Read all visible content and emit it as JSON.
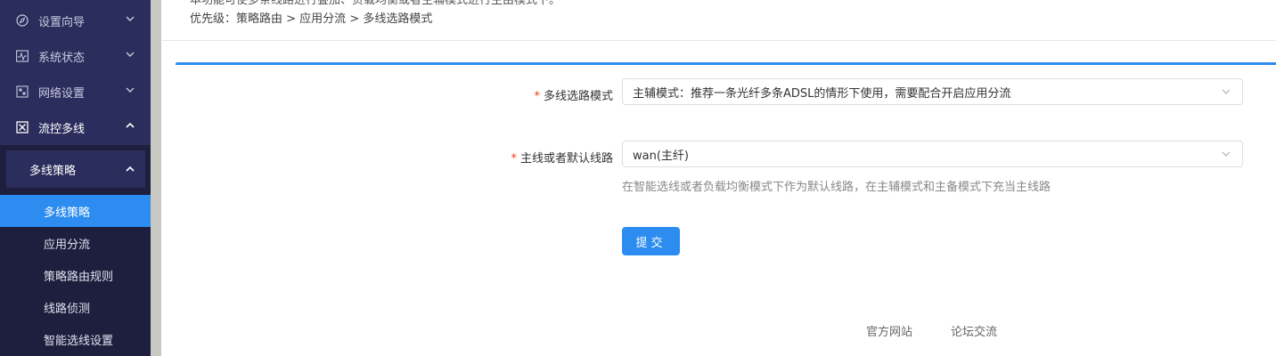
{
  "sidebar": {
    "items": [
      {
        "label": "设置向导",
        "icon": "compass-icon"
      },
      {
        "label": "系统状态",
        "icon": "activity-icon"
      },
      {
        "label": "网络设置",
        "icon": "network-icon"
      },
      {
        "label": "流控多线",
        "icon": "multiline-icon"
      }
    ],
    "submenu": {
      "group_label": "多线策略",
      "leaves": [
        "多线策略",
        "应用分流",
        "策略路由规则",
        "线路侦测",
        "智能选线设置"
      ],
      "selected_index": 0
    }
  },
  "header": {
    "partial_text": "本功能可使多条线路进行叠加、负载均衡或者主辅模式进行主由模式下。",
    "priority_text": "优先级：策略路由 > 应用分流 > 多线选路模式"
  },
  "form": {
    "mode_label": "多线选路模式",
    "mode_value": "主辅模式：推荐一条光纤多条ADSL的情形下使用，需要配合开启应用分流",
    "line_label": "主线或者默认线路",
    "line_value": "wan(主纤)",
    "line_hint": "在智能选线或者负载均衡模式下作为默认线路，在主辅模式和主备模式下充当主线路",
    "required_mark": "*",
    "submit_label": "提交"
  },
  "footer": {
    "official_site": "官方网站",
    "forum": "论坛交流"
  },
  "colors": {
    "sidebar_bg": "#2b2d5c",
    "accent": "#2d8cf0",
    "required": "#ed4014"
  }
}
